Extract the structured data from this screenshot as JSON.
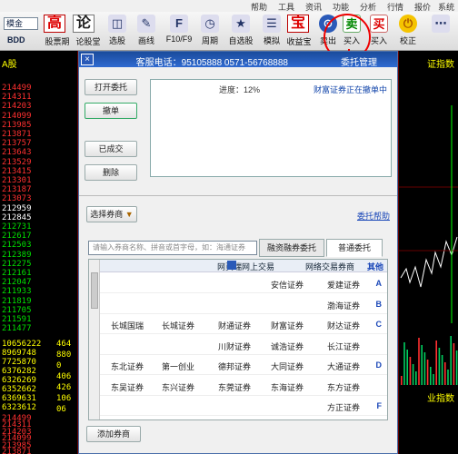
{
  "menubar": {
    "items": [
      "帮助",
      "工具",
      "资讯",
      "功能",
      "分析",
      "行情",
      "报价",
      "系统"
    ]
  },
  "toolbar": {
    "combo_value": "模金",
    "combo_sub": "BDD",
    "buttons": [
      {
        "label": "校正",
        "icon": "power-icon"
      },
      {
        "label": "买入",
        "icon": "buy-icon"
      },
      {
        "label": "卖出",
        "icon": "sell-icon"
      },
      {
        "label": "买入",
        "icon": "circled-buy-icon"
      },
      {
        "label": "收益宝",
        "icon": "treasure-icon"
      },
      {
        "label": "模拟",
        "icon": "simulate-icon"
      },
      {
        "label": "自选股",
        "icon": "star-icon"
      },
      {
        "label": "周期",
        "icon": "clock-icon"
      },
      {
        "label": "F10/F9",
        "icon": "f10-icon"
      },
      {
        "label": "画线",
        "icon": "pen-icon"
      },
      {
        "label": "选股",
        "icon": "select-icon"
      },
      {
        "label": "论股堂",
        "icon": "discuss-icon"
      },
      {
        "label": "股票期",
        "icon": "high-icon"
      }
    ],
    "red_buttons": [
      "高",
      "论",
      "宝",
      "买",
      "卖"
    ]
  },
  "left_column": {
    "header": "A股",
    "values": [
      "214499",
      "214311",
      "214203",
      "214099",
      "213985",
      "213871",
      "213757",
      "213643",
      "213529",
      "213415",
      "213301",
      "213187",
      "213073",
      "212959",
      "212845",
      "212731",
      "212617",
      "212503",
      "212389",
      "212275",
      "212161",
      "212047",
      "211933",
      "211819",
      "211705",
      "211591",
      "211477"
    ],
    "vol_values": [
      "464",
      "880",
      "0",
      "406",
      "426",
      "106",
      "06"
    ],
    "vol_values2": [
      "10656222",
      "8969748",
      "7725870",
      "6376282",
      "6326269",
      "6352662",
      "6369631",
      "6323612"
    ],
    "bottom_values": [
      "214499",
      "214311",
      "214203",
      "214099",
      "213985",
      "213871"
    ]
  },
  "right_chart": {
    "header": "证指数",
    "footer": "业指数"
  },
  "dialog": {
    "title": "委托管理",
    "phone_label": "客服电话：95105888 0571-56768888",
    "buttons": {
      "close": "×",
      "cancel_order": "撤单",
      "open_order": "打开委托",
      "already_filled": "已成交",
      "delete": "删除",
      "select_broker": "选择券商",
      "add_broker": "添加券商"
    },
    "orders": {
      "text": "财富证券正在撤单中",
      "progress_label": "进度：12%"
    },
    "links": {
      "help": "委托帮助"
    },
    "tabs": [
      "普通委托",
      "融资融券委托"
    ],
    "search_placeholder": "请输入券商名称、拼音或首字母，如：海通证券",
    "list_header": [
      "其他",
      "网络交易券商",
      "网页端网上交易"
    ],
    "rows": [
      {
        "letter": "A",
        "cells": [
          "爱建证券",
          "安信证券"
        ]
      },
      {
        "letter": "B",
        "cells": [
          "渤海证券"
        ]
      },
      {
        "letter": "C",
        "cells": [
          "财达证券",
          "财富证券",
          "财通证券",
          "长城证券",
          "长城国瑞"
        ]
      },
      {
        "letter": "",
        "cells": [
          "长江证券",
          "诚浩证券",
          "川财证券"
        ]
      },
      {
        "letter": "D",
        "cells": [
          "大通证券",
          "大同证券",
          "德邦证券",
          "第一创业",
          "东北证券"
        ]
      },
      {
        "letter": "",
        "cells": [
          "东方证券",
          "东海证券",
          "东莞证券",
          "东兴证券",
          "东吴证券"
        ]
      },
      {
        "letter": "F",
        "cells": [
          "方正证券"
        ]
      }
    ]
  },
  "colors": {
    "accent_red": "#e00000",
    "title_blue": "#1a4b9c",
    "quote_yellow": "#ffff00",
    "quote_red": "#ff3030",
    "quote_green": "#00e000"
  }
}
